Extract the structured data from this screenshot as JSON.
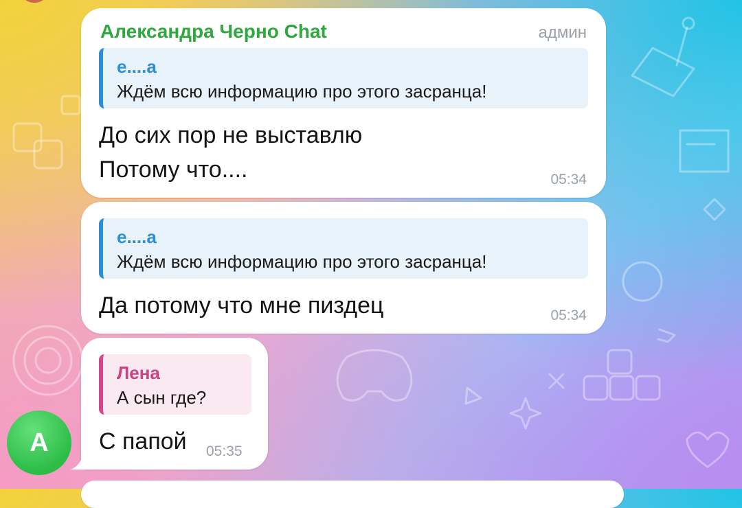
{
  "messages": [
    {
      "sender": "Александра Черно Chat",
      "role": "админ",
      "reply": {
        "author": "е....а",
        "text": "Ждём всю информацию про этого засранца!"
      },
      "lines": [
        "До сих пор не выставлю",
        "Потому что...."
      ],
      "time": "05:34"
    },
    {
      "reply": {
        "author": "е....а",
        "text": "Ждём всю информацию про этого засранца!"
      },
      "lines": [
        "Да потому что мне пиздец"
      ],
      "time": "05:34"
    },
    {
      "reply": {
        "author": "Лена",
        "text": "А сын где?"
      },
      "lines": [
        "С папой"
      ],
      "time": "05:35"
    }
  ],
  "avatar": {
    "letter": "A",
    "color": "#2cbd47"
  },
  "colors": {
    "sender_name": "#2fa83e",
    "reply_blue": "#2d8ed6",
    "reply_pink": "#d2458a",
    "timestamp": "#9aa1a8"
  },
  "background": {
    "style": "gradient-doodle-pattern",
    "icons": [
      "gamepad-icon",
      "dice-icon",
      "joystick-icon",
      "console-icon",
      "puzzle-icon",
      "star-icon",
      "flag-icon",
      "heart-icon",
      "keyboard-keys-icon"
    ]
  }
}
